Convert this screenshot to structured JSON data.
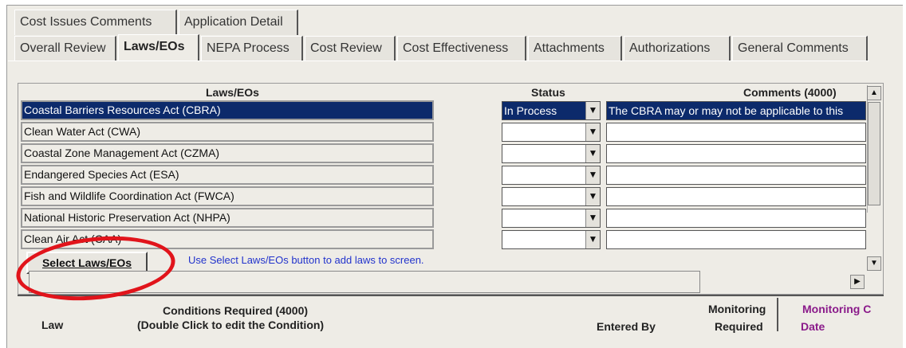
{
  "tabs_top": [
    "Cost Issues Comments",
    "Application Detail"
  ],
  "tabs_main": [
    "Overall Review",
    "Laws/EOs",
    "NEPA Process",
    "Cost Review",
    "Cost Effectiveness",
    "Attachments",
    "Authorizations",
    "General Comments"
  ],
  "active_tab": "Laws/EOs",
  "grid": {
    "headers": {
      "laws": "Laws/EOs",
      "status": "Status",
      "comments": "Comments (4000)"
    },
    "rows": [
      {
        "law": "Coastal Barriers Resources Act (CBRA)",
        "status": "In Process",
        "comment": "The CBRA may or may not be applicable to this"
      },
      {
        "law": "Clean Water Act (CWA)",
        "status": "",
        "comment": ""
      },
      {
        "law": "Coastal Zone Management Act (CZMA)",
        "status": "",
        "comment": ""
      },
      {
        "law": "Endangered Species Act (ESA)",
        "status": "",
        "comment": ""
      },
      {
        "law": "Fish and Wildlife Coordination Act (FWCA)",
        "status": "",
        "comment": ""
      },
      {
        "law": "National Historic Preservation Act (NHPA)",
        "status": "",
        "comment": ""
      },
      {
        "law": "Clean Air Act (CAA)",
        "status": "",
        "comment": ""
      }
    ]
  },
  "select_button": "Select Laws/EOs",
  "hint_text": "Use Select Laws/EOs button to add laws to screen.",
  "bottom_headers": {
    "law": "Law",
    "conditions_line1": "Conditions Required (4000)",
    "conditions_line2": "(Double Click to edit the Condition)",
    "entered_by": "Entered By",
    "monitoring_line1": "Monitoring",
    "monitoring_line2": "Required",
    "monitoring_c_line1": "Monitoring C",
    "monitoring_c_line2": "Date"
  },
  "colors": {
    "selection": "#0c2a6b",
    "highlight_circle": "#e1141b",
    "hint": "#2233cc",
    "purple": "#8a1a8a"
  }
}
